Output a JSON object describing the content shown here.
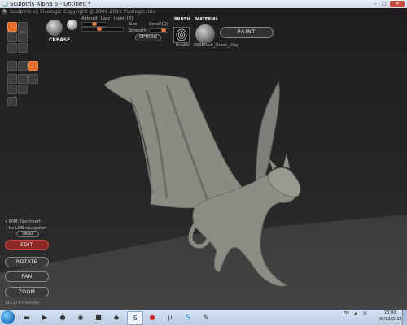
{
  "window": {
    "title": "Sculptris Alpha 6 - Untitled *",
    "app_name": "Sculptris by Pixologic",
    "copyright": "Copyright @ 2009-2011 Pixologic, Inc.",
    "minimize": "–",
    "maximize": "□",
    "close": "✕"
  },
  "toolbar": {
    "brush_name": "CREASE",
    "airbrush_label": "Airbrush",
    "lazy_label": "Lazy",
    "invert_label": "Invert",
    "invert_key": "[X]",
    "size_label": "Size",
    "detail_label": "Detail",
    "detail_key": "[Q]",
    "strength_label": "Strength",
    "options_label": "OPTIONS",
    "brush_header": "BRUSH",
    "brush_sub": "Enable",
    "material_header": "MATERIAL",
    "material_name": "SSSBrush_Green_Clay",
    "paint_label": "PAINT",
    "accent_color": "#e06a2a"
  },
  "sidebar": {
    "hint_1": "• RMB flips invert",
    "hint_2": "• No LMB navigation",
    "undo_label": "UNDO"
  },
  "controls": {
    "edit": "EDIT",
    "rotate": "ROTATE",
    "pan": "PAN",
    "zoom": "ZOOM",
    "triangles": "161174 triangles",
    "edit_color": "#8a2a22"
  },
  "taskbar": {
    "lang": "EN",
    "time": "13:00",
    "date": "06/12/2012",
    "items": [
      "folder-icon",
      "media-player-icon",
      "firefox-icon",
      "steam-icon",
      "dragon-age-icon",
      "game-icon",
      "sculptris-icon",
      "record-icon",
      "torrent-icon",
      "skype-icon",
      "paint-icon"
    ]
  }
}
